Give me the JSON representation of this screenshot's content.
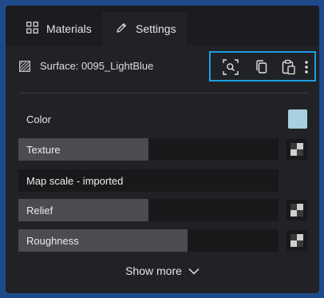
{
  "tabs": {
    "materials": {
      "label": "Materials",
      "icon": "grid-icon"
    },
    "settings": {
      "label": "Settings",
      "icon": "pencil-icon",
      "active": true
    }
  },
  "surface": {
    "label": "Surface: 0095_LightBlue",
    "icon": "hatch-pattern-icon"
  },
  "actions": [
    "search-image-icon",
    "copy-icon",
    "paste-icon",
    "more-vertical-icon"
  ],
  "color": {
    "label": "Color",
    "swatch": "#a8d0df"
  },
  "properties": {
    "texture": {
      "label": "Texture",
      "fill": 0.5
    },
    "map_scale": {
      "label": "Map scale - imported"
    },
    "relief": {
      "label": "Relief",
      "fill": 0.5
    },
    "roughness": {
      "label": "Roughness",
      "fill": 0.65
    }
  },
  "show_more": {
    "label": "Show more",
    "icon": "chevron-down-icon"
  },
  "colors": {
    "highlight": "#1aa0e6",
    "panel": "#212225",
    "background": "#1e4a8a"
  }
}
